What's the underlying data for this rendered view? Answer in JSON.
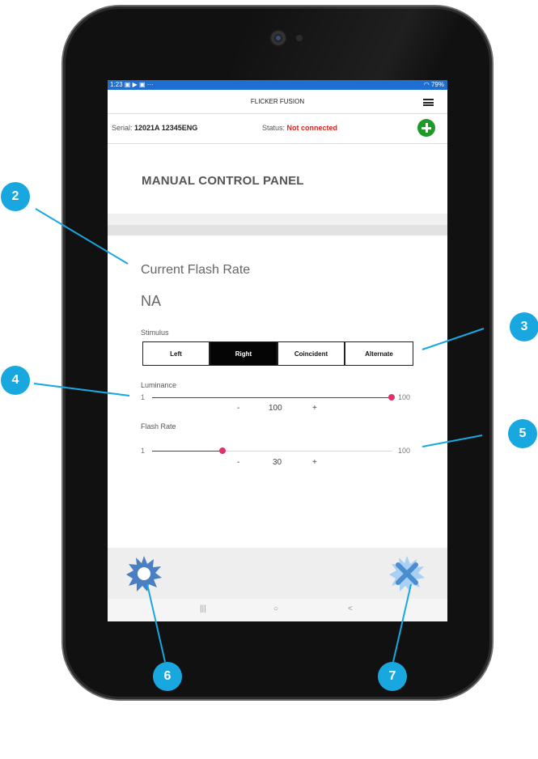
{
  "status_bar": {
    "left": "1:23 ▣ ▶ ▣ ···",
    "right": "79%"
  },
  "app": {
    "title": "FLICKER FUSION"
  },
  "info": {
    "serial_label": "Serial:",
    "serial_value": "12021A 12345ENG",
    "status_label": "Status:",
    "status_value": "Not connected"
  },
  "panel": {
    "title": "MANUAL CONTROL PANEL"
  },
  "flash": {
    "label": "Current Flash Rate",
    "value": "NA"
  },
  "stimulus": {
    "label": "Stimulus",
    "options": [
      "Left",
      "Right",
      "Coincident",
      "Alternate"
    ],
    "selected": "Right"
  },
  "luminance": {
    "label": "Luminance",
    "min": "1",
    "max": "100",
    "value": "100",
    "minus": "-",
    "plus": "+"
  },
  "flash_rate": {
    "label": "Flash Rate",
    "min": "1",
    "max": "100",
    "value": "30",
    "minus": "-",
    "plus": "+"
  },
  "nav": {
    "recent": "|||",
    "home": "○",
    "back": "<"
  },
  "callouts": [
    "2",
    "3",
    "4",
    "5",
    "6",
    "7"
  ],
  "colors": {
    "status_bar": "#1f6fd1",
    "accent": "#e0316b",
    "track_active": "#3f3aa8",
    "track_inactive": "#f3c7cb",
    "status_error": "#e0231c",
    "add_button": "#1e9a2a",
    "callout": "#19a7df",
    "gear_icon": "#4a7fc1",
    "close_icon": "#7fb3e6"
  },
  "icons": {
    "add": "plus-circle-icon",
    "menu": "hamburger-menu-icon",
    "settings": "gear-burst-icon",
    "close": "close-burst-icon"
  }
}
